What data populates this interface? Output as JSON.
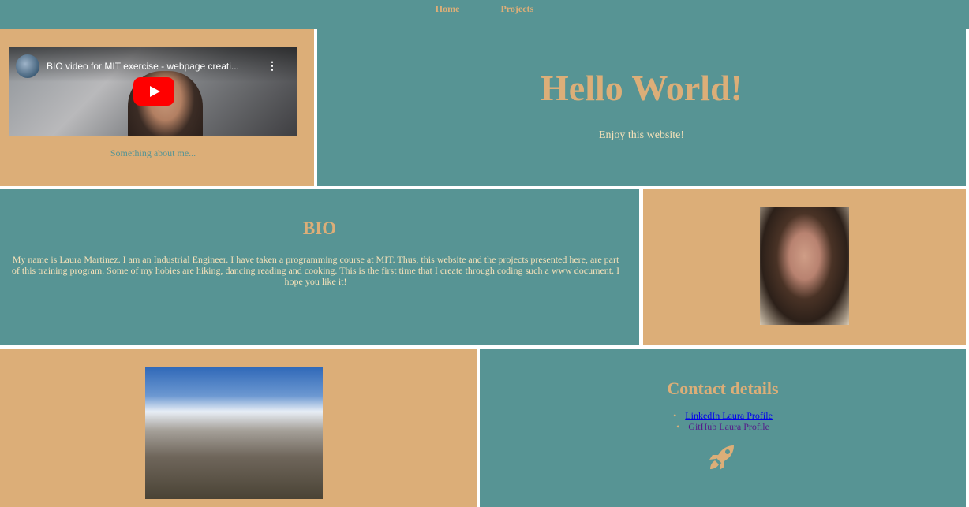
{
  "nav": {
    "home": "Home",
    "projects": "Projects"
  },
  "video": {
    "title": "BIO video for MIT exercise - webpage creati...",
    "menu": "⋮",
    "caption": "Something about me..."
  },
  "hero": {
    "title": "Hello World!",
    "subtitle": "Enjoy this website!"
  },
  "bio": {
    "title": "BIO",
    "text": "My name is Laura Martinez. I am an Industrial Engineer. I have taken a programming course at MIT. Thus, this website and the projects presented here, are part of this training program. Some of my hobies are hiking, dancing reading and cooking. This is the first time that I create through coding such a www document. I hope you like it!"
  },
  "contact": {
    "title": "Contact details",
    "links": [
      "LinkedIn Laura Profile",
      "GitHub Laura Profile"
    ],
    "icon": "rocket-icon"
  },
  "colors": {
    "teal": "#579494",
    "tan": "#dcae78",
    "cream": "#f3e0b8"
  }
}
